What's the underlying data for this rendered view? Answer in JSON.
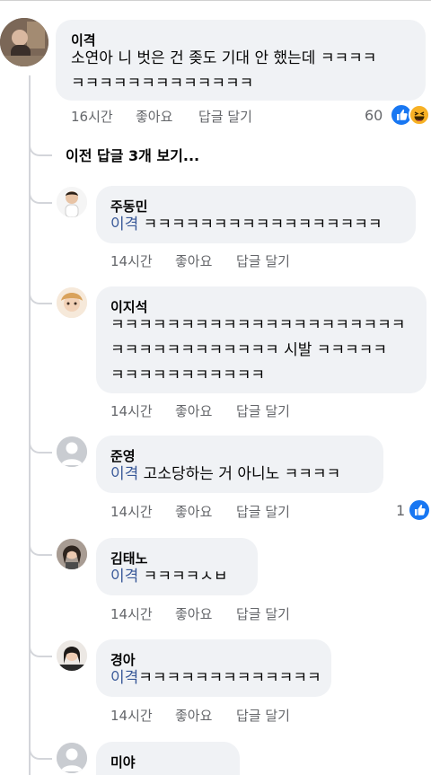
{
  "top_comment": {
    "author": "이격",
    "line1": "소연아 니 벗은 건 좆도 기대 안 했는데 ㅋㅋㅋㅋ",
    "line2": "ㅋㅋㅋㅋㅋㅋㅋㅋㅋㅋㅋㅋㅋ",
    "time": "16시간",
    "like_label": "좋아요",
    "reply_label": "답글 달기",
    "reaction_count": "60"
  },
  "view_previous": "이전 답글 3개 보기...",
  "replies": [
    {
      "author": "주동민",
      "mention": "이격",
      "lines": [
        " ㅋㅋㅋㅋㅋㅋㅋㅋㅋㅋㅋㅋㅋㅋㅋㅋㅋ"
      ],
      "time": "14시간",
      "like_label": "좋아요",
      "reply_label": "답글 달기"
    },
    {
      "author": "이지석",
      "lines": [
        "ㅋㅋㅋㅋㅋㅋㅋㅋㅋㅋㅋㅋㅋㅋㅋㅋㅋㅋㅋㅋㅋ",
        "ㅋㅋㅋㅋㅋㅋㅋㅋㅋㅋㅋㅋ 시발 ㅋㅋㅋㅋㅋ",
        "ㅋㅋㅋㅋㅋㅋㅋㅋㅋㅋㅋ"
      ],
      "time": "14시간",
      "like_label": "좋아요",
      "reply_label": "답글 달기"
    },
    {
      "author": "준영",
      "mention": "이격",
      "lines": [
        " 고소당하는 거 아니노 ㅋㅋㅋㅋ"
      ],
      "time": "14시간",
      "like_label": "좋아요",
      "reply_label": "답글 달기",
      "reaction_count": "1"
    },
    {
      "author": "김태노",
      "mention": "이격",
      "lines": [
        " ㅋㅋㅋㅋㅅㅂ"
      ],
      "time": "14시간",
      "like_label": "좋아요",
      "reply_label": "답글 달기"
    },
    {
      "author": "경아",
      "mention": "이격",
      "lines": [
        "ㅋㅋㅋㅋㅋㅋㅋㅋㅋㅋㅋㅋㅋ"
      ],
      "time": "14시간",
      "like_label": "좋아요",
      "reply_label": "답글 달기"
    },
    {
      "author": "미야"
    }
  ],
  "icons": {
    "like": "thumbs-up-icon",
    "haha": "laughing-face-icon",
    "default_avatar": "default-avatar-icon"
  },
  "colors": {
    "bubble": "#f0f2f5",
    "mention": "#385898",
    "meta_text": "#65676b",
    "like_blue": "#1877f2",
    "haha_yellow": "#f7b125"
  }
}
